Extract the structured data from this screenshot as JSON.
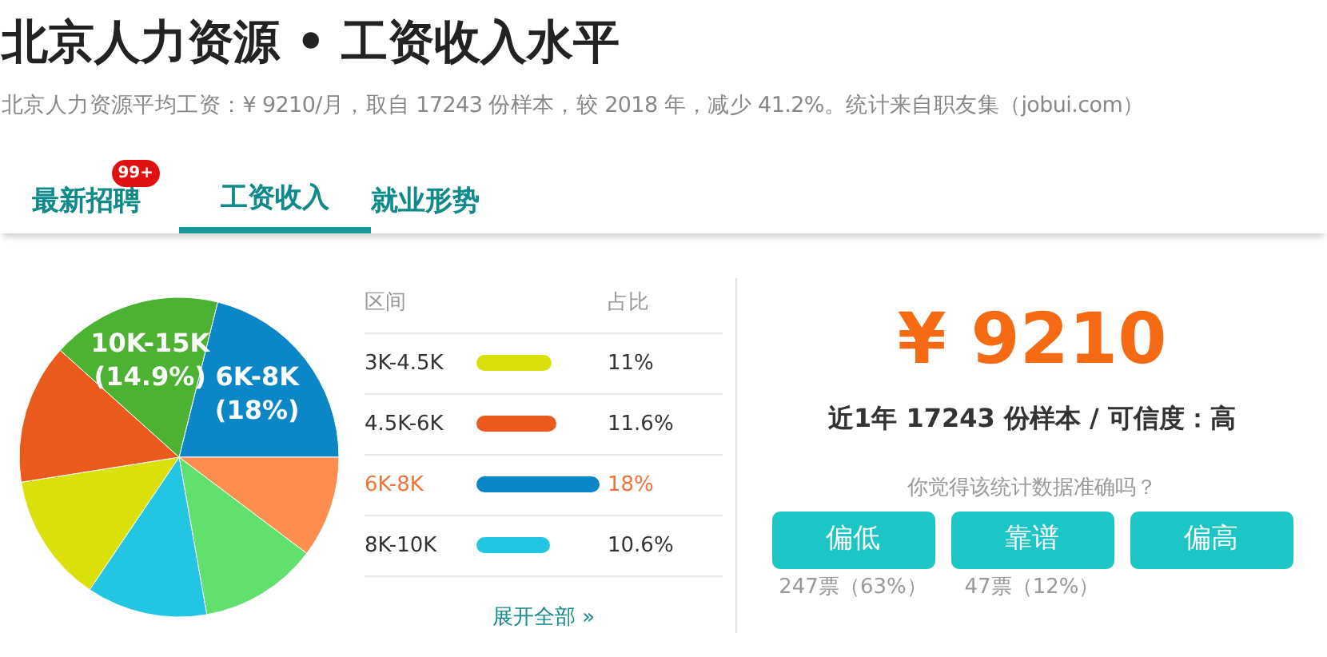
{
  "title": "北京人力资源 • 工资收入水平",
  "subtitle": "北京人力资源平均工资：¥ 9210/月，取自 17243 份样本，较 2018 年，减少 41.2%。统计来自职友集（jobui.com）",
  "tabs": [
    {
      "label": "最新招聘",
      "selected": false,
      "badge": "99+"
    },
    {
      "label": "工资收入",
      "selected": true
    },
    {
      "label": "就业形势",
      "selected": false
    }
  ],
  "pie": {
    "slices": [
      {
        "color": "#0b86c6",
        "label": "6K-8K",
        "percent": "(18%)"
      },
      {
        "color": "#fe8d50"
      },
      {
        "color": "#62e06e"
      },
      {
        "color": "#23c6e2"
      },
      {
        "color": "#d9e00a"
      },
      {
        "color": "#ea5a1c"
      },
      {
        "color": "#4bb331",
        "label": "10K-15K",
        "percent": "(14.9%)"
      }
    ]
  },
  "table": {
    "columns": [
      "区间",
      "占比"
    ],
    "rows": [
      {
        "range": "3K-4.5K",
        "color": "#d9e00a",
        "share": "11%",
        "selected": false
      },
      {
        "range": "4.5K-6K",
        "color": "#ea5a1c",
        "share": "11.6%",
        "selected": false
      },
      {
        "range": "6K-8K",
        "color": "#0b86c6",
        "share": "18%",
        "selected": true
      },
      {
        "range": "8K-10K",
        "color": "#23c6e2",
        "share": "10.6%",
        "selected": false
      }
    ],
    "more_link": "展开全部 »"
  },
  "summary": {
    "salary": "¥ 9210",
    "detail": "近1年 17243 份样本 / 可信度：高",
    "question": "你觉得该统计数据准确吗？",
    "votes": [
      {
        "label": "偏低",
        "count": "247票（63%）"
      },
      {
        "label": "靠谱",
        "count": "47票（12%）"
      },
      {
        "label": "偏高"
      }
    ]
  }
}
